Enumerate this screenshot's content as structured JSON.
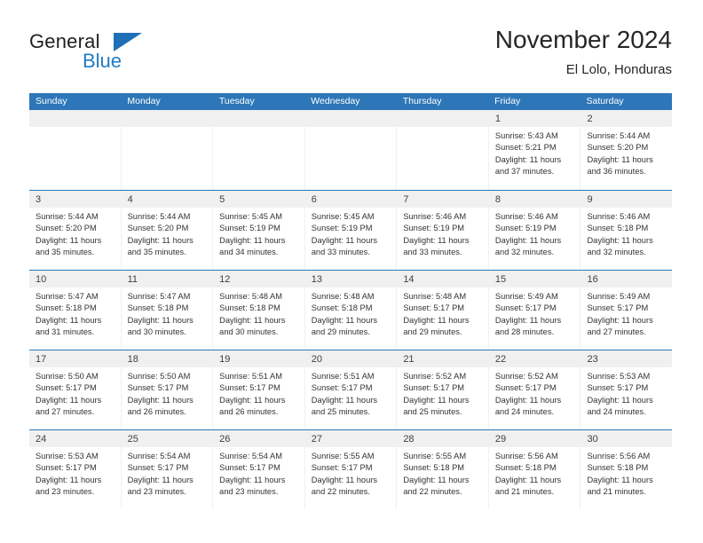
{
  "brand": {
    "name_part1": "General",
    "name_part2": "Blue",
    "triangle_color": "#1f6fb6",
    "blue_color": "#1f7cc4"
  },
  "header": {
    "title": "November 2024",
    "subtitle": "El Lolo, Honduras"
  },
  "theme": {
    "header_band": "#2d76b8",
    "daynum_band": "#f0f0f0",
    "row_divider": "#2d76b8",
    "cell_bg": "#ffffff",
    "text": "#333333"
  },
  "weekdays": [
    "Sunday",
    "Monday",
    "Tuesday",
    "Wednesday",
    "Thursday",
    "Friday",
    "Saturday"
  ],
  "weeks": [
    [
      {
        "day": "",
        "empty": true,
        "sunrise": "",
        "sunset": "",
        "daylight_line1": "",
        "daylight_line2": ""
      },
      {
        "day": "",
        "empty": true,
        "sunrise": "",
        "sunset": "",
        "daylight_line1": "",
        "daylight_line2": ""
      },
      {
        "day": "",
        "empty": true,
        "sunrise": "",
        "sunset": "",
        "daylight_line1": "",
        "daylight_line2": ""
      },
      {
        "day": "",
        "empty": true,
        "sunrise": "",
        "sunset": "",
        "daylight_line1": "",
        "daylight_line2": ""
      },
      {
        "day": "",
        "empty": true,
        "sunrise": "",
        "sunset": "",
        "daylight_line1": "",
        "daylight_line2": ""
      },
      {
        "day": "1",
        "empty": false,
        "sunrise": "Sunrise: 5:43 AM",
        "sunset": "Sunset: 5:21 PM",
        "daylight_line1": "Daylight: 11 hours",
        "daylight_line2": "and 37 minutes."
      },
      {
        "day": "2",
        "empty": false,
        "sunrise": "Sunrise: 5:44 AM",
        "sunset": "Sunset: 5:20 PM",
        "daylight_line1": "Daylight: 11 hours",
        "daylight_line2": "and 36 minutes."
      }
    ],
    [
      {
        "day": "3",
        "empty": false,
        "sunrise": "Sunrise: 5:44 AM",
        "sunset": "Sunset: 5:20 PM",
        "daylight_line1": "Daylight: 11 hours",
        "daylight_line2": "and 35 minutes."
      },
      {
        "day": "4",
        "empty": false,
        "sunrise": "Sunrise: 5:44 AM",
        "sunset": "Sunset: 5:20 PM",
        "daylight_line1": "Daylight: 11 hours",
        "daylight_line2": "and 35 minutes."
      },
      {
        "day": "5",
        "empty": false,
        "sunrise": "Sunrise: 5:45 AM",
        "sunset": "Sunset: 5:19 PM",
        "daylight_line1": "Daylight: 11 hours",
        "daylight_line2": "and 34 minutes."
      },
      {
        "day": "6",
        "empty": false,
        "sunrise": "Sunrise: 5:45 AM",
        "sunset": "Sunset: 5:19 PM",
        "daylight_line1": "Daylight: 11 hours",
        "daylight_line2": "and 33 minutes."
      },
      {
        "day": "7",
        "empty": false,
        "sunrise": "Sunrise: 5:46 AM",
        "sunset": "Sunset: 5:19 PM",
        "daylight_line1": "Daylight: 11 hours",
        "daylight_line2": "and 33 minutes."
      },
      {
        "day": "8",
        "empty": false,
        "sunrise": "Sunrise: 5:46 AM",
        "sunset": "Sunset: 5:19 PM",
        "daylight_line1": "Daylight: 11 hours",
        "daylight_line2": "and 32 minutes."
      },
      {
        "day": "9",
        "empty": false,
        "sunrise": "Sunrise: 5:46 AM",
        "sunset": "Sunset: 5:18 PM",
        "daylight_line1": "Daylight: 11 hours",
        "daylight_line2": "and 32 minutes."
      }
    ],
    [
      {
        "day": "10",
        "empty": false,
        "sunrise": "Sunrise: 5:47 AM",
        "sunset": "Sunset: 5:18 PM",
        "daylight_line1": "Daylight: 11 hours",
        "daylight_line2": "and 31 minutes."
      },
      {
        "day": "11",
        "empty": false,
        "sunrise": "Sunrise: 5:47 AM",
        "sunset": "Sunset: 5:18 PM",
        "daylight_line1": "Daylight: 11 hours",
        "daylight_line2": "and 30 minutes."
      },
      {
        "day": "12",
        "empty": false,
        "sunrise": "Sunrise: 5:48 AM",
        "sunset": "Sunset: 5:18 PM",
        "daylight_line1": "Daylight: 11 hours",
        "daylight_line2": "and 30 minutes."
      },
      {
        "day": "13",
        "empty": false,
        "sunrise": "Sunrise: 5:48 AM",
        "sunset": "Sunset: 5:18 PM",
        "daylight_line1": "Daylight: 11 hours",
        "daylight_line2": "and 29 minutes."
      },
      {
        "day": "14",
        "empty": false,
        "sunrise": "Sunrise: 5:48 AM",
        "sunset": "Sunset: 5:17 PM",
        "daylight_line1": "Daylight: 11 hours",
        "daylight_line2": "and 29 minutes."
      },
      {
        "day": "15",
        "empty": false,
        "sunrise": "Sunrise: 5:49 AM",
        "sunset": "Sunset: 5:17 PM",
        "daylight_line1": "Daylight: 11 hours",
        "daylight_line2": "and 28 minutes."
      },
      {
        "day": "16",
        "empty": false,
        "sunrise": "Sunrise: 5:49 AM",
        "sunset": "Sunset: 5:17 PM",
        "daylight_line1": "Daylight: 11 hours",
        "daylight_line2": "and 27 minutes."
      }
    ],
    [
      {
        "day": "17",
        "empty": false,
        "sunrise": "Sunrise: 5:50 AM",
        "sunset": "Sunset: 5:17 PM",
        "daylight_line1": "Daylight: 11 hours",
        "daylight_line2": "and 27 minutes."
      },
      {
        "day": "18",
        "empty": false,
        "sunrise": "Sunrise: 5:50 AM",
        "sunset": "Sunset: 5:17 PM",
        "daylight_line1": "Daylight: 11 hours",
        "daylight_line2": "and 26 minutes."
      },
      {
        "day": "19",
        "empty": false,
        "sunrise": "Sunrise: 5:51 AM",
        "sunset": "Sunset: 5:17 PM",
        "daylight_line1": "Daylight: 11 hours",
        "daylight_line2": "and 26 minutes."
      },
      {
        "day": "20",
        "empty": false,
        "sunrise": "Sunrise: 5:51 AM",
        "sunset": "Sunset: 5:17 PM",
        "daylight_line1": "Daylight: 11 hours",
        "daylight_line2": "and 25 minutes."
      },
      {
        "day": "21",
        "empty": false,
        "sunrise": "Sunrise: 5:52 AM",
        "sunset": "Sunset: 5:17 PM",
        "daylight_line1": "Daylight: 11 hours",
        "daylight_line2": "and 25 minutes."
      },
      {
        "day": "22",
        "empty": false,
        "sunrise": "Sunrise: 5:52 AM",
        "sunset": "Sunset: 5:17 PM",
        "daylight_line1": "Daylight: 11 hours",
        "daylight_line2": "and 24 minutes."
      },
      {
        "day": "23",
        "empty": false,
        "sunrise": "Sunrise: 5:53 AM",
        "sunset": "Sunset: 5:17 PM",
        "daylight_line1": "Daylight: 11 hours",
        "daylight_line2": "and 24 minutes."
      }
    ],
    [
      {
        "day": "24",
        "empty": false,
        "sunrise": "Sunrise: 5:53 AM",
        "sunset": "Sunset: 5:17 PM",
        "daylight_line1": "Daylight: 11 hours",
        "daylight_line2": "and 23 minutes."
      },
      {
        "day": "25",
        "empty": false,
        "sunrise": "Sunrise: 5:54 AM",
        "sunset": "Sunset: 5:17 PM",
        "daylight_line1": "Daylight: 11 hours",
        "daylight_line2": "and 23 minutes."
      },
      {
        "day": "26",
        "empty": false,
        "sunrise": "Sunrise: 5:54 AM",
        "sunset": "Sunset: 5:17 PM",
        "daylight_line1": "Daylight: 11 hours",
        "daylight_line2": "and 23 minutes."
      },
      {
        "day": "27",
        "empty": false,
        "sunrise": "Sunrise: 5:55 AM",
        "sunset": "Sunset: 5:17 PM",
        "daylight_line1": "Daylight: 11 hours",
        "daylight_line2": "and 22 minutes."
      },
      {
        "day": "28",
        "empty": false,
        "sunrise": "Sunrise: 5:55 AM",
        "sunset": "Sunset: 5:18 PM",
        "daylight_line1": "Daylight: 11 hours",
        "daylight_line2": "and 22 minutes."
      },
      {
        "day": "29",
        "empty": false,
        "sunrise": "Sunrise: 5:56 AM",
        "sunset": "Sunset: 5:18 PM",
        "daylight_line1": "Daylight: 11 hours",
        "daylight_line2": "and 21 minutes."
      },
      {
        "day": "30",
        "empty": false,
        "sunrise": "Sunrise: 5:56 AM",
        "sunset": "Sunset: 5:18 PM",
        "daylight_line1": "Daylight: 11 hours",
        "daylight_line2": "and 21 minutes."
      }
    ]
  ]
}
